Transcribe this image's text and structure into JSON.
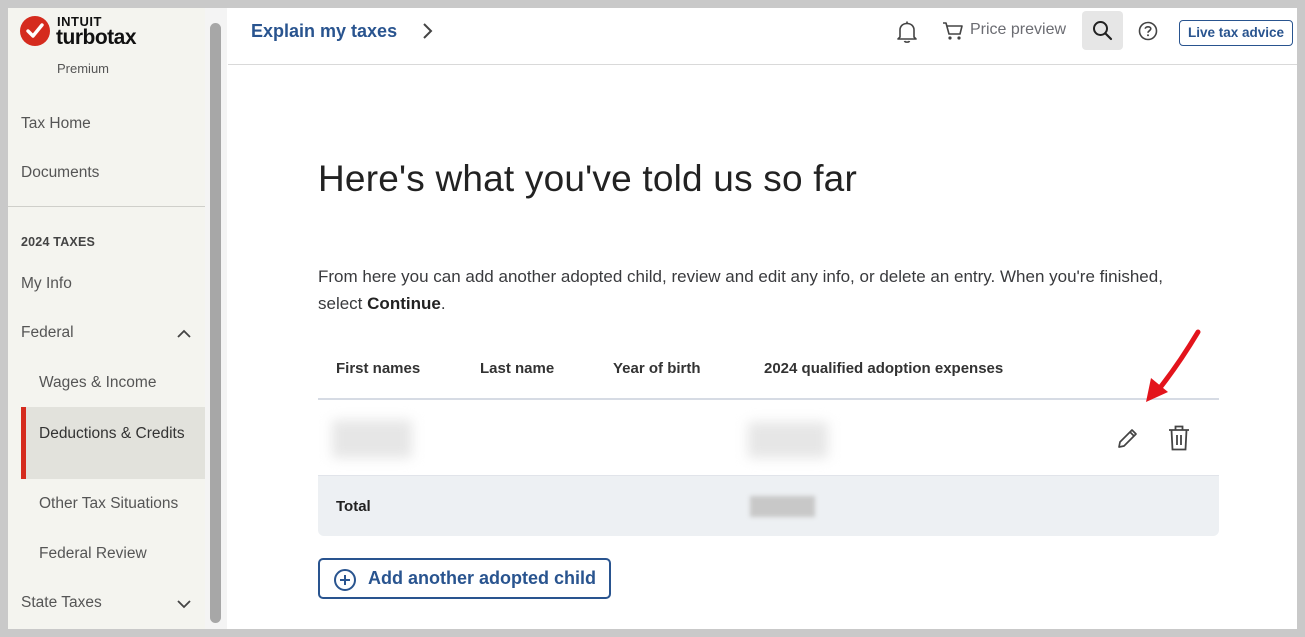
{
  "brand": {
    "company": "INTUIT",
    "product": "turbotax",
    "edition": "Premium",
    "accent": "#d52b1e"
  },
  "sidebar": {
    "items_top": [
      {
        "label": "Tax Home"
      },
      {
        "label": "Documents"
      }
    ],
    "section_label": "2024 TAXES",
    "my_info": "My Info",
    "federal": "Federal",
    "federal_sub": [
      {
        "label": "Wages & Income"
      },
      {
        "label": "Deductions & Credits",
        "active": true
      },
      {
        "label": "Other Tax Situations"
      },
      {
        "label": "Federal Review"
      }
    ],
    "state_taxes": "State Taxes"
  },
  "header": {
    "breadcrumb": "Explain my taxes",
    "price_preview": "Price preview",
    "live_help": "Live tax advice",
    "link_color": "#29548f"
  },
  "main": {
    "title": "Here's what you've told us so far",
    "intro_text": "From here you can add another adopted child, review and edit any info, or delete an entry. When you're finished, select",
    "intro_bold": "Continue",
    "intro_end": ".",
    "table": {
      "columns": [
        "First names",
        "Last name",
        "Year of birth",
        "2024 qualified adoption expenses"
      ],
      "rows": [
        {
          "first_name": "",
          "last_name": "",
          "year_of_birth": "",
          "expenses": ""
        }
      ],
      "total_label": "Total",
      "total_value": ""
    },
    "add_button": "Add another adopted child"
  }
}
